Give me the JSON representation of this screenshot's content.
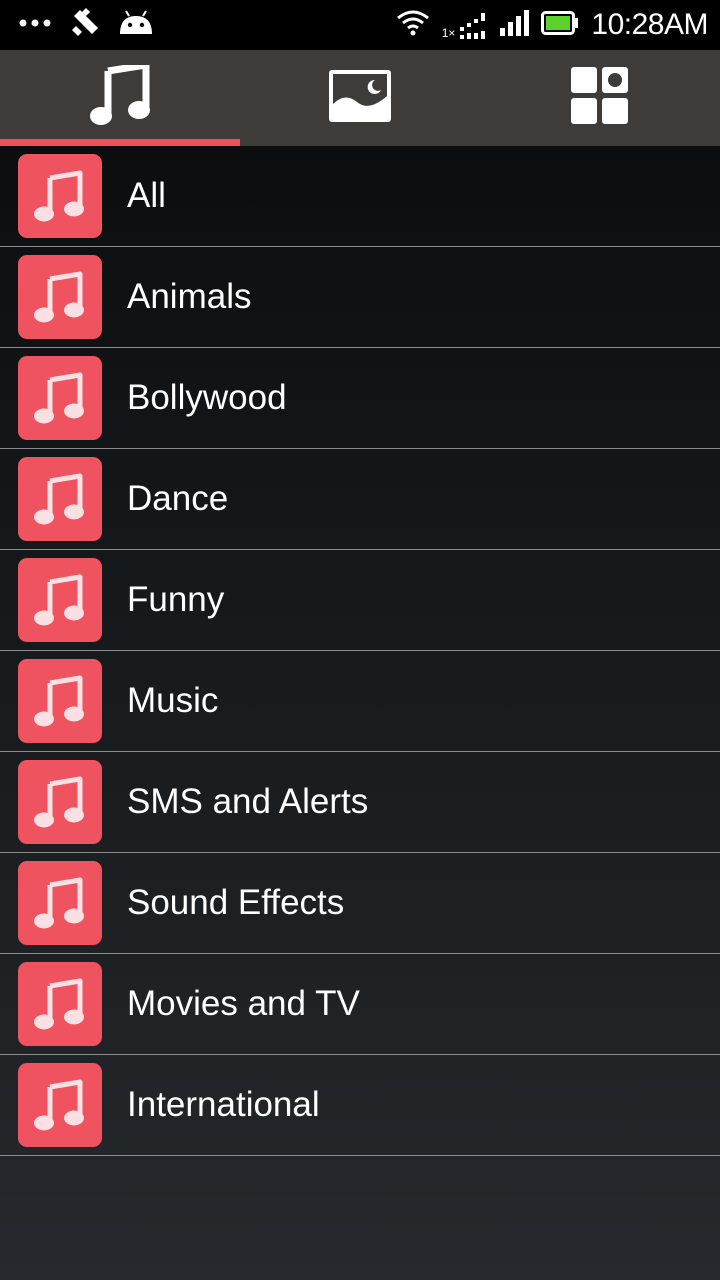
{
  "status_bar": {
    "time": "10:28AM",
    "network_label": "1×",
    "left_icons": [
      "more-dots-icon",
      "tools-icon",
      "android-icon"
    ],
    "right_icons": [
      "wifi-icon",
      "data-activity-icon",
      "cell-signal-icon",
      "battery-icon"
    ]
  },
  "tabs": [
    {
      "icon": "music-note-icon",
      "active": true
    },
    {
      "icon": "image-icon",
      "active": false
    },
    {
      "icon": "apps-grid-icon",
      "active": false
    }
  ],
  "categories": [
    {
      "label": "All"
    },
    {
      "label": "Animals"
    },
    {
      "label": "Bollywood"
    },
    {
      "label": "Dance"
    },
    {
      "label": "Funny"
    },
    {
      "label": "Music"
    },
    {
      "label": "SMS and Alerts"
    },
    {
      "label": "Sound Effects"
    },
    {
      "label": "Movies and TV"
    },
    {
      "label": "International"
    }
  ],
  "colors": {
    "accent": "#ee505a",
    "icon_tile": "#ef5360",
    "tab_bar": "#3e3b39",
    "battery_green": "#5bd12c"
  }
}
